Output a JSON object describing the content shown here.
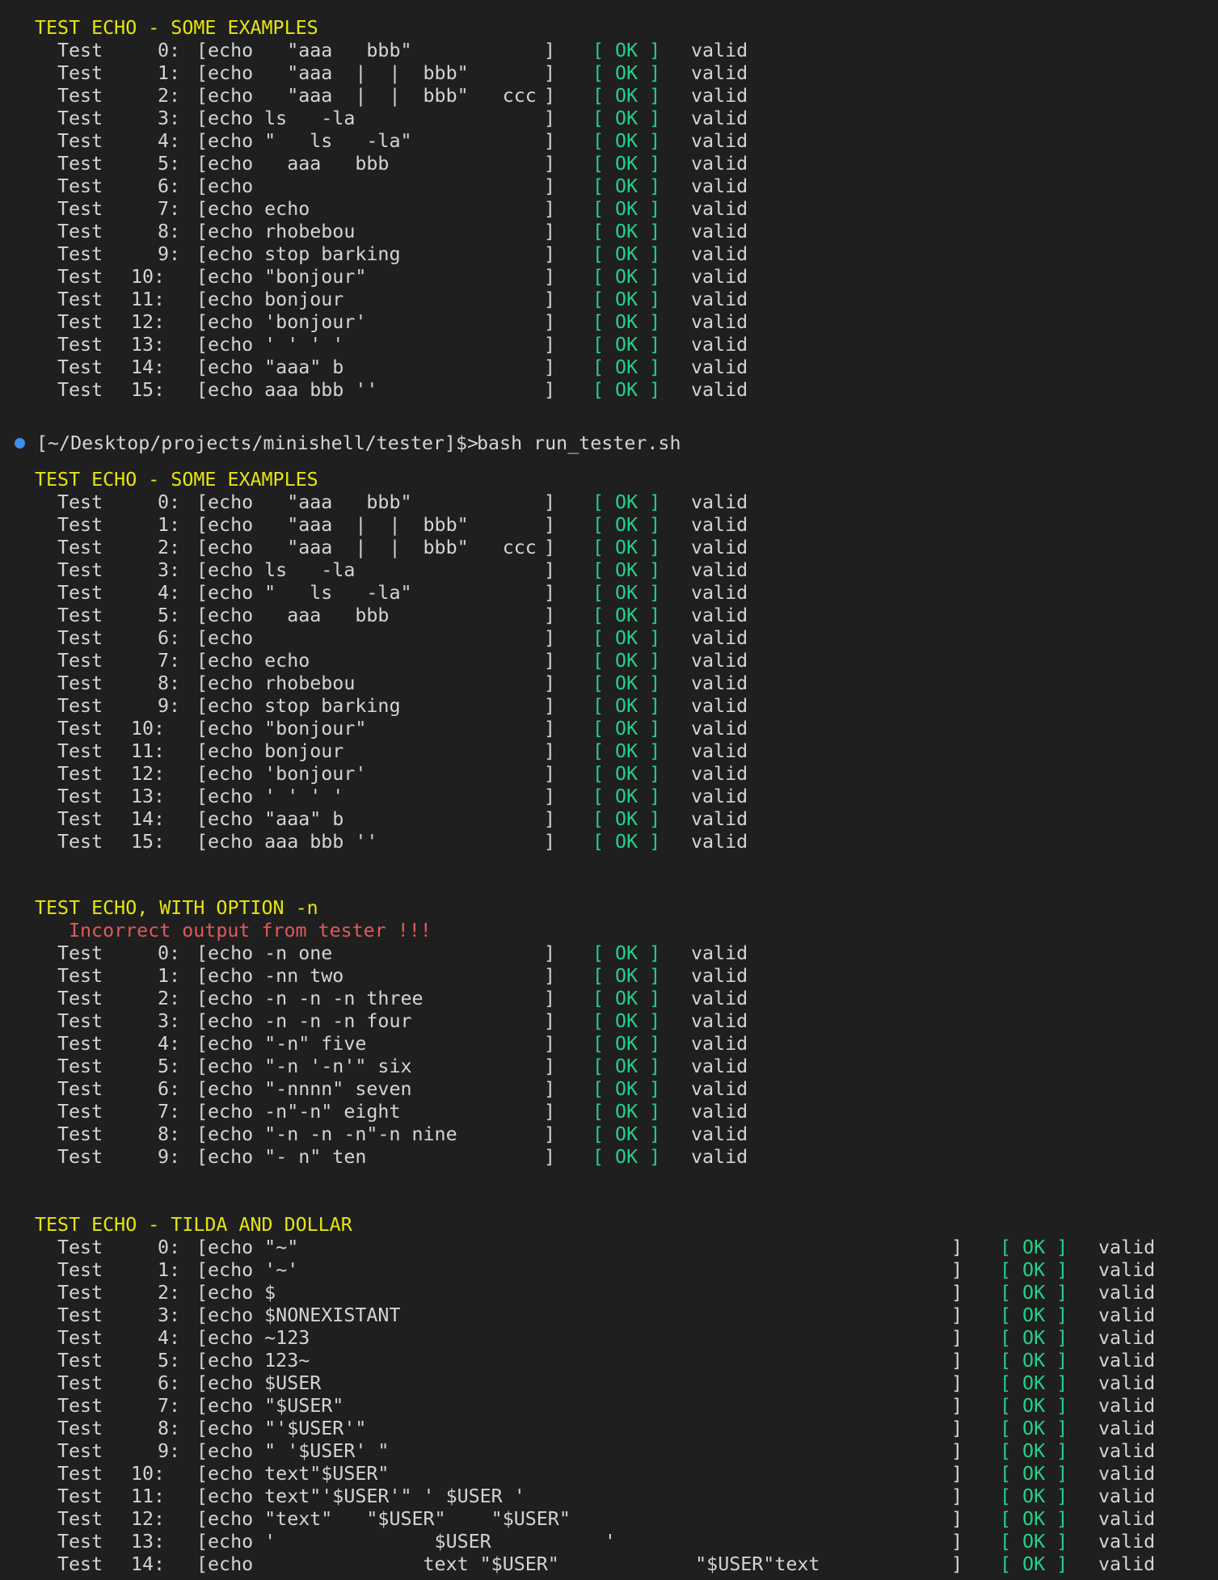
{
  "prompt": {
    "path": "[~/Desktop/projects/minishell/tester]$>",
    "command": "bash run_tester.sh"
  },
  "sections": [
    {
      "header": "TEST ECHO - SOME EXAMPLES",
      "warning": "",
      "rows": [
        {
          "label": "Test",
          "num": "0:",
          "cmd": "[echo   \"aaa   bbb\"",
          "close": "]",
          "status": "[ OK ]",
          "result": "valid"
        },
        {
          "label": "Test",
          "num": "1:",
          "cmd": "[echo   \"aaa  |  |  bbb\"",
          "close": "]",
          "status": "[ OK ]",
          "result": "valid"
        },
        {
          "label": "Test",
          "num": "2:",
          "cmd": "[echo   \"aaa  |  |  bbb\"   ccc",
          "close": "]",
          "status": "[ OK ]",
          "result": "valid"
        },
        {
          "label": "Test",
          "num": "3:",
          "cmd": "[echo ls   -la",
          "close": "]",
          "status": "[ OK ]",
          "result": "valid"
        },
        {
          "label": "Test",
          "num": "4:",
          "cmd": "[echo \"   ls   -la\"",
          "close": "]",
          "status": "[ OK ]",
          "result": "valid"
        },
        {
          "label": "Test",
          "num": "5:",
          "cmd": "[echo   aaa   bbb",
          "close": "]",
          "status": "[ OK ]",
          "result": "valid"
        },
        {
          "label": "Test",
          "num": "6:",
          "cmd": "[echo",
          "close": "]",
          "status": "[ OK ]",
          "result": "valid"
        },
        {
          "label": "Test",
          "num": "7:",
          "cmd": "[echo echo",
          "close": "]",
          "status": "[ OK ]",
          "result": "valid"
        },
        {
          "label": "Test",
          "num": "8:",
          "cmd": "[echo rhobebou",
          "close": "]",
          "status": "[ OK ]",
          "result": "valid"
        },
        {
          "label": "Test",
          "num": "9:",
          "cmd": "[echo stop barking",
          "close": "]",
          "status": "[ OK ]",
          "result": "valid"
        },
        {
          "label": "Test",
          "num": "10:",
          "cmd": "[echo \"bonjour\"",
          "close": "]",
          "status": "[ OK ]",
          "result": "valid"
        },
        {
          "label": "Test",
          "num": "11:",
          "cmd": "[echo bonjour",
          "close": "]",
          "status": "[ OK ]",
          "result": "valid"
        },
        {
          "label": "Test",
          "num": "12:",
          "cmd": "[echo 'bonjour'",
          "close": "]",
          "status": "[ OK ]",
          "result": "valid"
        },
        {
          "label": "Test",
          "num": "13:",
          "cmd": "[echo ' ' ' '",
          "close": "]",
          "status": "[ OK ]",
          "result": "valid"
        },
        {
          "label": "Test",
          "num": "14:",
          "cmd": "[echo \"aaa\" b",
          "close": "]",
          "status": "[ OK ]",
          "result": "valid"
        },
        {
          "label": "Test",
          "num": "15:",
          "cmd": "[echo aaa bbb ''",
          "close": "]",
          "status": "[ OK ]",
          "result": "valid"
        }
      ]
    },
    {
      "header": "TEST ECHO - SOME EXAMPLES",
      "warning": "",
      "rows": [
        {
          "label": "Test",
          "num": "0:",
          "cmd": "[echo   \"aaa   bbb\"",
          "close": "]",
          "status": "[ OK ]",
          "result": "valid"
        },
        {
          "label": "Test",
          "num": "1:",
          "cmd": "[echo   \"aaa  |  |  bbb\"",
          "close": "]",
          "status": "[ OK ]",
          "result": "valid"
        },
        {
          "label": "Test",
          "num": "2:",
          "cmd": "[echo   \"aaa  |  |  bbb\"   ccc",
          "close": "]",
          "status": "[ OK ]",
          "result": "valid"
        },
        {
          "label": "Test",
          "num": "3:",
          "cmd": "[echo ls   -la",
          "close": "]",
          "status": "[ OK ]",
          "result": "valid"
        },
        {
          "label": "Test",
          "num": "4:",
          "cmd": "[echo \"   ls   -la\"",
          "close": "]",
          "status": "[ OK ]",
          "result": "valid"
        },
        {
          "label": "Test",
          "num": "5:",
          "cmd": "[echo   aaa   bbb",
          "close": "]",
          "status": "[ OK ]",
          "result": "valid"
        },
        {
          "label": "Test",
          "num": "6:",
          "cmd": "[echo",
          "close": "]",
          "status": "[ OK ]",
          "result": "valid"
        },
        {
          "label": "Test",
          "num": "7:",
          "cmd": "[echo echo",
          "close": "]",
          "status": "[ OK ]",
          "result": "valid"
        },
        {
          "label": "Test",
          "num": "8:",
          "cmd": "[echo rhobebou",
          "close": "]",
          "status": "[ OK ]",
          "result": "valid"
        },
        {
          "label": "Test",
          "num": "9:",
          "cmd": "[echo stop barking",
          "close": "]",
          "status": "[ OK ]",
          "result": "valid"
        },
        {
          "label": "Test",
          "num": "10:",
          "cmd": "[echo \"bonjour\"",
          "close": "]",
          "status": "[ OK ]",
          "result": "valid"
        },
        {
          "label": "Test",
          "num": "11:",
          "cmd": "[echo bonjour",
          "close": "]",
          "status": "[ OK ]",
          "result": "valid"
        },
        {
          "label": "Test",
          "num": "12:",
          "cmd": "[echo 'bonjour'",
          "close": "]",
          "status": "[ OK ]",
          "result": "valid"
        },
        {
          "label": "Test",
          "num": "13:",
          "cmd": "[echo ' ' ' '",
          "close": "]",
          "status": "[ OK ]",
          "result": "valid"
        },
        {
          "label": "Test",
          "num": "14:",
          "cmd": "[echo \"aaa\" b",
          "close": "]",
          "status": "[ OK ]",
          "result": "valid"
        },
        {
          "label": "Test",
          "num": "15:",
          "cmd": "[echo aaa bbb ''",
          "close": "]",
          "status": "[ OK ]",
          "result": "valid"
        }
      ]
    },
    {
      "header": "TEST ECHO, WITH OPTION -n",
      "warning": "Incorrect output from tester !!!",
      "rows": [
        {
          "label": "Test",
          "num": "0:",
          "cmd": "[echo -n one",
          "close": "]",
          "status": "[ OK ]",
          "result": "valid"
        },
        {
          "label": "Test",
          "num": "1:",
          "cmd": "[echo -nn two",
          "close": "]",
          "status": "[ OK ]",
          "result": "valid"
        },
        {
          "label": "Test",
          "num": "2:",
          "cmd": "[echo -n -n -n three",
          "close": "]",
          "status": "[ OK ]",
          "result": "valid"
        },
        {
          "label": "Test",
          "num": "3:",
          "cmd": "[echo -n -n -n four",
          "close": "]",
          "status": "[ OK ]",
          "result": "valid"
        },
        {
          "label": "Test",
          "num": "4:",
          "cmd": "[echo \"-n\" five",
          "close": "]",
          "status": "[ OK ]",
          "result": "valid"
        },
        {
          "label": "Test",
          "num": "5:",
          "cmd": "[echo \"-n '-n'\" six",
          "close": "]",
          "status": "[ OK ]",
          "result": "valid"
        },
        {
          "label": "Test",
          "num": "6:",
          "cmd": "[echo \"-nnnn\" seven",
          "close": "]",
          "status": "[ OK ]",
          "result": "valid"
        },
        {
          "label": "Test",
          "num": "7:",
          "cmd": "[echo -n\"-n\" eight",
          "close": "]",
          "status": "[ OK ]",
          "result": "valid"
        },
        {
          "label": "Test",
          "num": "8:",
          "cmd": "[echo \"-n -n -n\"-n nine",
          "close": "]",
          "status": "[ OK ]",
          "result": "valid"
        },
        {
          "label": "Test",
          "num": "9:",
          "cmd": "[echo \"- n\" ten",
          "close": "]",
          "status": "[ OK ]",
          "result": "valid"
        }
      ]
    },
    {
      "header": "TEST ECHO - TILDA AND DOLLAR",
      "warning": "",
      "rows": [
        {
          "label": "Test",
          "num": "0:",
          "cmd": "[echo \"~\"",
          "close": "]",
          "status": "[ OK ]",
          "result": "valid"
        },
        {
          "label": "Test",
          "num": "1:",
          "cmd": "[echo '~'",
          "close": "]",
          "status": "[ OK ]",
          "result": "valid"
        },
        {
          "label": "Test",
          "num": "2:",
          "cmd": "[echo $",
          "close": "]",
          "status": "[ OK ]",
          "result": "valid"
        },
        {
          "label": "Test",
          "num": "3:",
          "cmd": "[echo $NONEXISTANT",
          "close": "]",
          "status": "[ OK ]",
          "result": "valid"
        },
        {
          "label": "Test",
          "num": "4:",
          "cmd": "[echo ~123",
          "close": "]",
          "status": "[ OK ]",
          "result": "valid"
        },
        {
          "label": "Test",
          "num": "5:",
          "cmd": "[echo 123~",
          "close": "]",
          "status": "[ OK ]",
          "result": "valid"
        },
        {
          "label": "Test",
          "num": "6:",
          "cmd": "[echo $USER",
          "close": "]",
          "status": "[ OK ]",
          "result": "valid"
        },
        {
          "label": "Test",
          "num": "7:",
          "cmd": "[echo \"$USER\"",
          "close": "]",
          "status": "[ OK ]",
          "result": "valid"
        },
        {
          "label": "Test",
          "num": "8:",
          "cmd": "[echo \"'$USER'\"",
          "close": "]",
          "status": "[ OK ]",
          "result": "valid"
        },
        {
          "label": "Test",
          "num": "9:",
          "cmd": "[echo \" '$USER' \"",
          "close": "]",
          "status": "[ OK ]",
          "result": "valid"
        },
        {
          "label": "Test",
          "num": "10:",
          "cmd": "[echo text\"$USER\"",
          "close": "]",
          "status": "[ OK ]",
          "result": "valid"
        },
        {
          "label": "Test",
          "num": "11:",
          "cmd": "[echo text\"'$USER'\" ' $USER '",
          "close": "]",
          "status": "[ OK ]",
          "result": "valid"
        },
        {
          "label": "Test",
          "num": "12:",
          "cmd": "[echo \"text\"   \"$USER\"    \"$USER\"",
          "close": "]",
          "status": "[ OK ]",
          "result": "valid"
        },
        {
          "label": "Test",
          "num": "13:",
          "cmd": "[echo '              $USER          '",
          "close": "]",
          "status": "[ OK ]",
          "result": "valid"
        },
        {
          "label": "Test",
          "num": "14:",
          "cmd": "[echo               text \"$USER\"            \"$USER\"text",
          "close": "]",
          "status": "[ OK ]",
          "result": "valid"
        }
      ]
    }
  ]
}
